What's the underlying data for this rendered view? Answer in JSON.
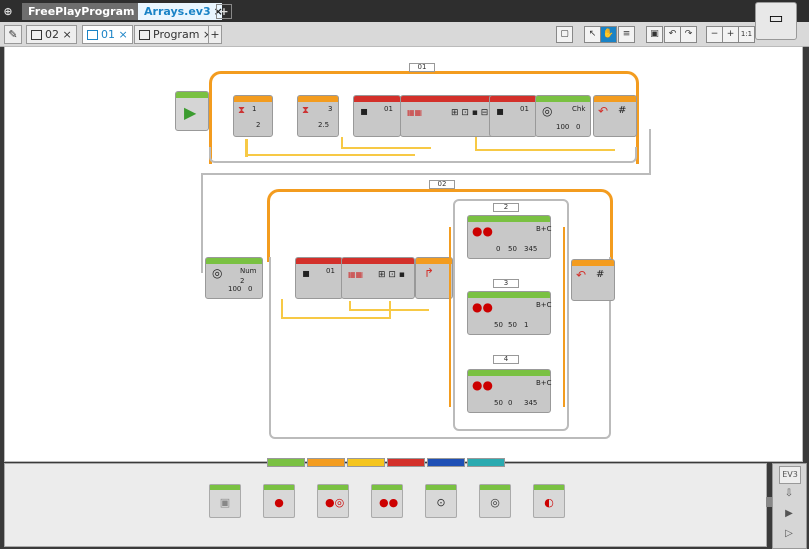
{
  "window": {
    "home_icon": "home-icon",
    "project_tab": "FreePlayProgram",
    "file_tab": "Arrays.ev3",
    "close_glyph": "×",
    "add_glyph": "+"
  },
  "program_tabs": [
    {
      "label": "02"
    },
    {
      "label": "01"
    },
    {
      "label": "Program"
    }
  ],
  "toolbar": {
    "zoom_reset": "1:1"
  },
  "canvas": {
    "loop1_label": "01",
    "loop2_label": "02",
    "block_labels": {
      "a1": "1",
      "a2": "3",
      "a3": "01",
      "a4": "01",
      "a5": "Chk",
      "b1": "Num 2",
      "b2": "01",
      "b3": "B+C",
      "b4": "B+C",
      "b5": "B+C"
    },
    "case_labels": [
      "2",
      "3",
      "4"
    ],
    "values": {
      "wait1": "2",
      "wait2": "2.5",
      "motor_a": "100",
      "motor_b": "0",
      "r1": [
        "0",
        "50",
        "345"
      ],
      "r2": [
        "50",
        "50",
        "1"
      ],
      "r3": [
        "50",
        "0",
        "345"
      ]
    }
  },
  "palette": {
    "categories": [
      {
        "color": "#7ac142"
      },
      {
        "color": "#f39c1f"
      },
      {
        "color": "#f5c51e"
      },
      {
        "color": "#d3302a"
      },
      {
        "color": "#1e4fb5"
      },
      {
        "color": "#2aaab0"
      }
    ]
  },
  "hardware": {
    "brick_label": "EV3"
  },
  "colors": {
    "action_green": "#7ac142",
    "flow_orange": "#f39c1f",
    "data_red": "#d3302a",
    "wire_yellow": "#f7c945"
  }
}
